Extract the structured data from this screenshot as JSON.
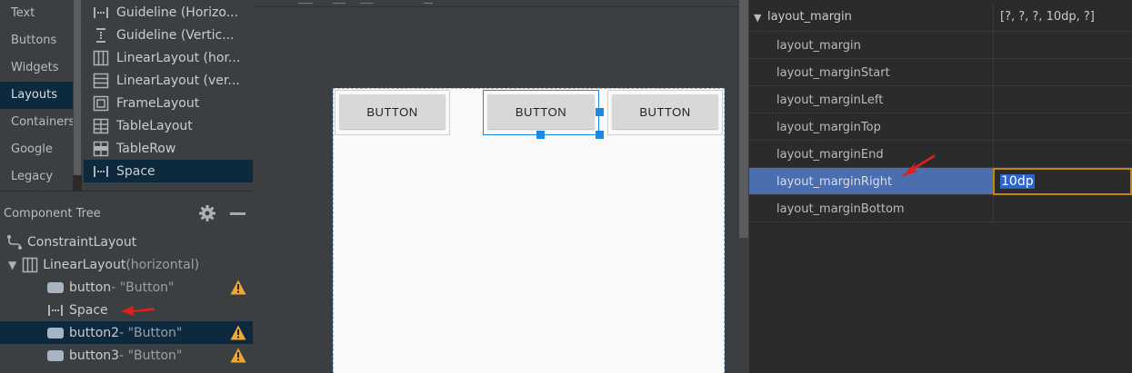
{
  "palette": {
    "categories": [
      {
        "label": "Text",
        "selected": false
      },
      {
        "label": "Buttons",
        "selected": false
      },
      {
        "label": "Widgets",
        "selected": false
      },
      {
        "label": "Layouts",
        "selected": true
      },
      {
        "label": "Containers",
        "selected": false
      },
      {
        "label": "Google",
        "selected": false
      },
      {
        "label": "Legacy",
        "selected": false
      }
    ],
    "items": [
      {
        "label": "Guideline (Horizo...",
        "icon": "guideline-horizontal-icon"
      },
      {
        "label": "Guideline (Vertic...",
        "icon": "guideline-vertical-icon"
      },
      {
        "label": "LinearLayout (hor...",
        "icon": "linearlayout-horizontal-icon"
      },
      {
        "label": "LinearLayout (ver...",
        "icon": "linearlayout-vertical-icon"
      },
      {
        "label": "FrameLayout",
        "icon": "framelayout-icon"
      },
      {
        "label": "TableLayout",
        "icon": "tablelayout-icon"
      },
      {
        "label": "TableRow",
        "icon": "tablerow-icon"
      },
      {
        "label": "Space",
        "icon": "space-icon",
        "selected": true
      }
    ]
  },
  "component_tree": {
    "title": "Component Tree",
    "rows": [
      {
        "label": "ConstraintLayout",
        "suffix": "",
        "icon": "constraintlayout-icon",
        "warning": false,
        "selected": false
      },
      {
        "label": "LinearLayout",
        "suffix": "(horizontal)",
        "icon": "linearlayout-icon",
        "warning": false,
        "selected": false
      },
      {
        "label": "button",
        "suffix": "- \"Button\"",
        "icon": "button-icon",
        "warning": true,
        "selected": false
      },
      {
        "label": "Space",
        "suffix": "",
        "icon": "space-icon",
        "warning": false,
        "selected": false
      },
      {
        "label": "button2",
        "suffix": "- \"Button\"",
        "icon": "button-icon",
        "warning": true,
        "selected": true
      },
      {
        "label": "button3",
        "suffix": "- \"Button\"",
        "icon": "button-icon",
        "warning": true,
        "selected": false
      }
    ]
  },
  "canvas": {
    "buttons": [
      {
        "label": "BUTTON",
        "selected": false
      },
      {
        "label": "BUTTON",
        "selected": true
      },
      {
        "label": "BUTTON",
        "selected": false
      }
    ]
  },
  "attributes": {
    "group_label": "layout_margin",
    "group_value": "[?, ?, ?, 10dp, ?]",
    "rows": [
      {
        "name": "layout_margin",
        "value": ""
      },
      {
        "name": "layout_marginStart",
        "value": ""
      },
      {
        "name": "layout_marginLeft",
        "value": ""
      },
      {
        "name": "layout_marginTop",
        "value": ""
      },
      {
        "name": "layout_marginEnd",
        "value": ""
      },
      {
        "name": "layout_marginRight",
        "value": "10dp",
        "selected": true
      },
      {
        "name": "layout_marginBottom",
        "value": ""
      }
    ]
  },
  "colors": {
    "selection_blue": "#1e88e5",
    "row_selected": "#4b6eaf",
    "warning": "#f0a732",
    "annotation_arrow": "#e0201b"
  }
}
